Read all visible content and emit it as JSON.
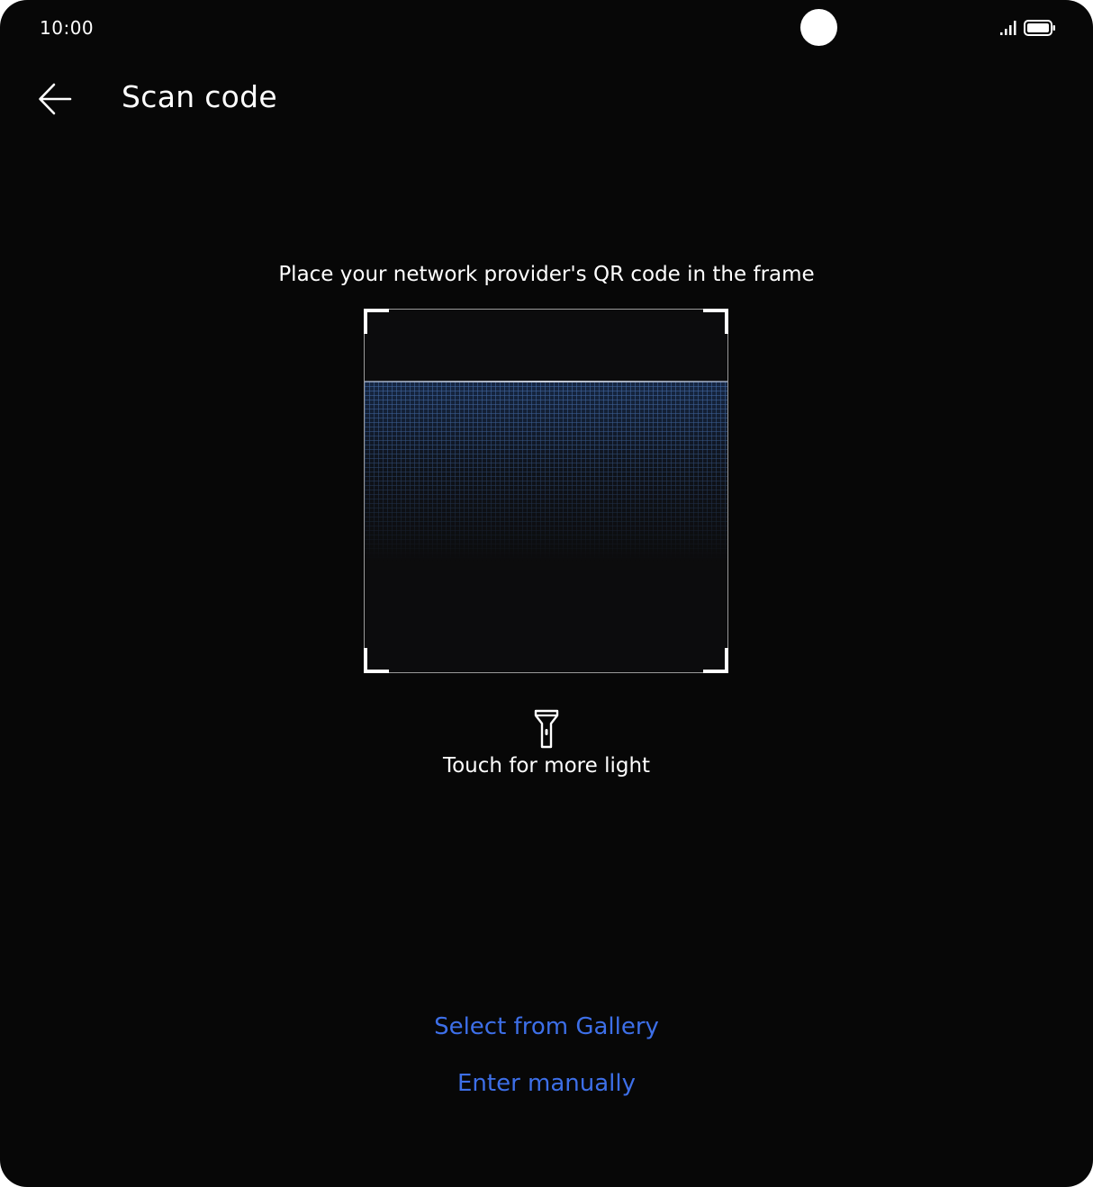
{
  "status_bar": {
    "time": "10:00",
    "signal_icon": "signal-icon",
    "battery_icon": "battery-icon"
  },
  "header": {
    "back_icon": "back-arrow-icon",
    "title": "Scan code"
  },
  "scanner": {
    "instruction": "Place your network provider's QR code in the frame",
    "flashlight_icon": "flashlight-icon",
    "flashlight_label": "Touch for more light"
  },
  "actions": {
    "gallery_label": "Select from Gallery",
    "manual_label": "Enter manually"
  },
  "colors": {
    "background": "#070707",
    "text": "#ffffff",
    "link": "#3d6fe8",
    "scan_grid": "#466eaa"
  }
}
